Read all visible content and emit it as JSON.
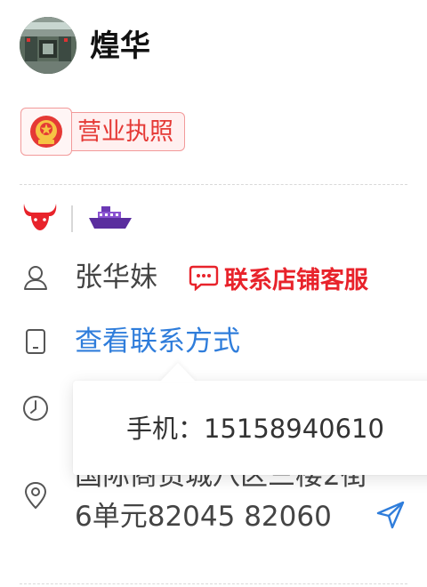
{
  "shop": {
    "name": "煌华",
    "license_label": "营业执照"
  },
  "badges": [
    {
      "icon": "bull-icon",
      "color": "#e8232b"
    },
    {
      "icon": "ship-icon",
      "color": "#7a3fbf"
    }
  ],
  "contact": {
    "name": "张华妹",
    "service_label": "联系店铺客服",
    "view_contact_label": "查看联系方式"
  },
  "popup": {
    "phone_text": "手机：15158940610"
  },
  "address": {
    "line1": "国际商贸城八区三楼2街",
    "line2": "6单元82045 82060"
  },
  "colors": {
    "accent_red": "#e8232b",
    "link_blue": "#2f7ddb",
    "license_border": "#f29a9a"
  }
}
